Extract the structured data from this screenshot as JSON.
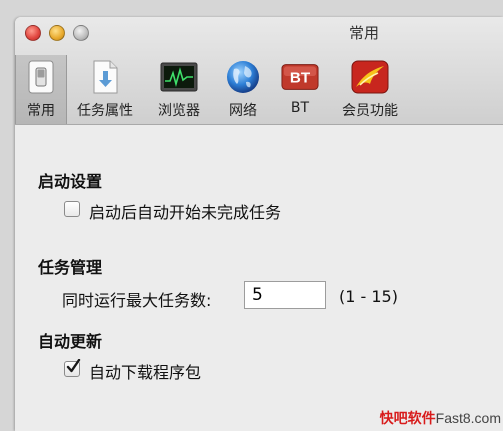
{
  "window": {
    "title": "常用"
  },
  "tabs": [
    {
      "label": "常用",
      "icon": "switch-icon"
    },
    {
      "label": "任务属性",
      "icon": "download-document-icon"
    },
    {
      "label": "浏览器",
      "icon": "activity-monitor-icon"
    },
    {
      "label": "网络",
      "icon": "globe-icon"
    },
    {
      "label": "BT",
      "icon": "bt-badge-icon",
      "badge_text": "BT"
    },
    {
      "label": "会员功能",
      "icon": "membership-icon"
    }
  ],
  "startup": {
    "title": "启动设置",
    "auto_start_label": "启动后自动开始未完成任务",
    "auto_start_checked": false
  },
  "tasks": {
    "title": "任务管理",
    "max_tasks_label": "同时运行最大任务数:",
    "max_tasks_value": "5",
    "range_hint": "(1 - 15)"
  },
  "update": {
    "title": "自动更新",
    "auto_download_label": "自动下载程序包",
    "auto_download_checked": true
  },
  "watermark": {
    "brand": "快吧软件",
    "site": "Fast8.com"
  },
  "colors": {
    "bt_badge": "#c0392b",
    "checkmark": "#1a5fb4"
  }
}
